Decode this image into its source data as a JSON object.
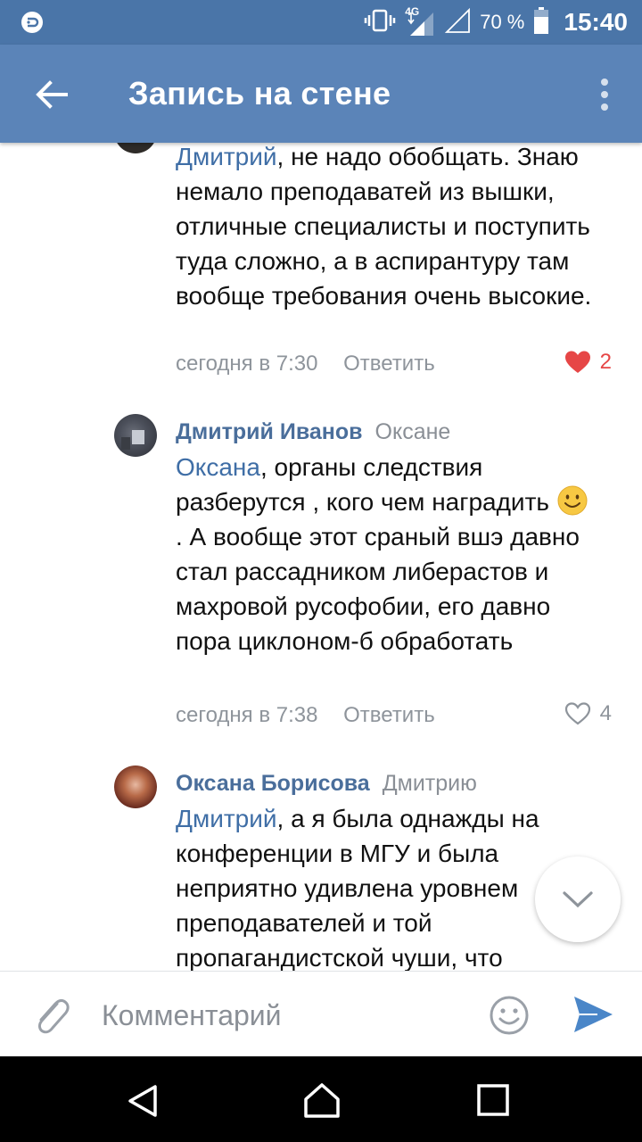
{
  "status_bar": {
    "network": "4G",
    "battery": "70 %",
    "time": "15:40"
  },
  "app_bar": {
    "title": "Запись на стене"
  },
  "comments": [
    {
      "mention": "Дмитрий",
      "text": ", не надо обобщать. Знаю немало преподаватей из вышки, отличные специалисты и поступить туда сложно, а в аспирантуру там вообще требования очень высокие.",
      "time": "сегодня в 7:30",
      "reply_label": "Ответить",
      "likes": "2",
      "liked": true
    },
    {
      "author": "Дмитрий Иванов",
      "reply_to": "Оксане",
      "mention": "Оксана",
      "text_1": ", органы следствия разберутся , кого чем наградить",
      "text_2": ". А вообще этот сраный вшэ давно стал рассадником либерастов и махровой русофобии, его давно пора циклоном-б обработать",
      "time": "сегодня в 7:38",
      "reply_label": "Ответить",
      "likes": "4",
      "liked": false
    },
    {
      "author": "Оксана Борисова",
      "reply_to": "Дмитрию",
      "mention": "Дмитрий",
      "text": ", а я была однажды на конференции в МГУ и была неприятно удивлена уровнем преподавателей и той пропагандистской чуши, что они"
    }
  ],
  "input_bar": {
    "placeholder": "Комментарий"
  },
  "colors": {
    "status_bar": "#4a75a8",
    "app_bar": "#5b84b8",
    "author": "#4a6e9b",
    "mention": "#3f6ea6",
    "like_active": "#e64646",
    "send": "#4a86c8"
  }
}
